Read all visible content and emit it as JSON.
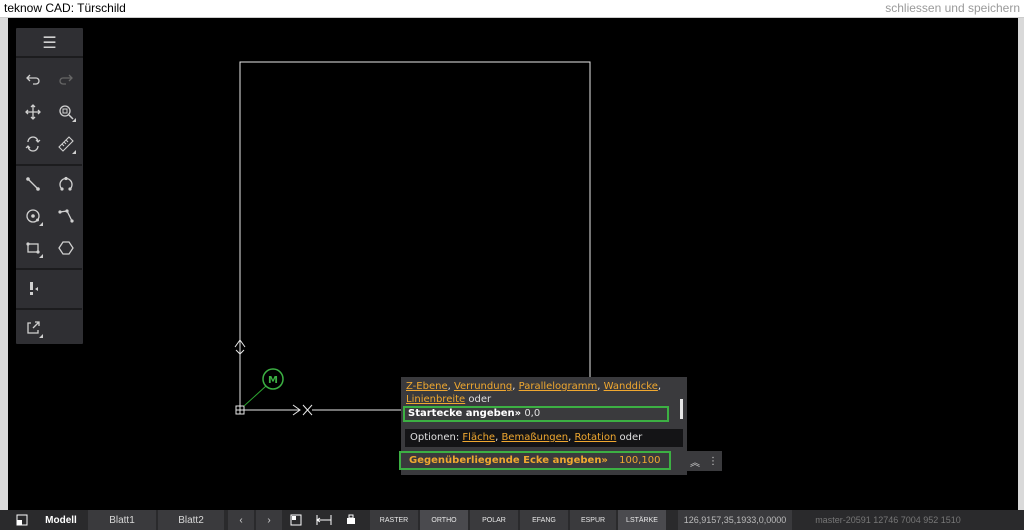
{
  "window": {
    "title": "teknow CAD: Türschild",
    "close_label": "schliessen und speichern"
  },
  "toolbar": {
    "menu_icon": "hamburger-icon",
    "tools": [
      {
        "name": "undo",
        "icon": "undo-icon"
      },
      {
        "name": "redo",
        "icon": "redo-icon"
      },
      {
        "name": "pan",
        "icon": "move-icon"
      },
      {
        "name": "zoom",
        "icon": "zoom-icon"
      },
      {
        "name": "orbit",
        "icon": "rotate-icon"
      },
      {
        "name": "measure",
        "icon": "ruler-icon"
      },
      {
        "name": "line",
        "icon": "line-icon"
      },
      {
        "name": "arc",
        "icon": "arc-icon"
      },
      {
        "name": "circle",
        "icon": "circle-icon"
      },
      {
        "name": "polyline",
        "icon": "polyline-icon"
      },
      {
        "name": "rectangle",
        "icon": "rectangle-icon"
      },
      {
        "name": "polygon",
        "icon": "hexagon-icon"
      },
      {
        "name": "error-check",
        "icon": "warning-icon"
      },
      {
        "name": "export",
        "icon": "export-icon"
      }
    ]
  },
  "drawing": {
    "marker_label": "M"
  },
  "command": {
    "history_line1_options": [
      "Z-Ebene",
      "Verrundung",
      "Parallelogramm",
      "Wanddicke"
    ],
    "history_line2_option": "Linienbreite",
    "history_oder": "oder",
    "start_prompt": "Startecke angeben»",
    "start_value": "0,0",
    "options_prefix": "Optionen:",
    "options": [
      "Fläche",
      "Bemaßungen",
      "Rotation"
    ],
    "options_suffix": "oder",
    "input_prompt": "Gegenüberliegende Ecke angeben»",
    "input_value": "100,100"
  },
  "bottom": {
    "tabs": [
      "Modell",
      "Blatt1",
      "Blatt2"
    ],
    "nav_prev": "‹",
    "nav_next": "›",
    "toggles": [
      {
        "label": "RASTER",
        "on": false
      },
      {
        "label": "ORTHO",
        "on": true
      },
      {
        "label": "POLAR",
        "on": false
      },
      {
        "label": "EFANG",
        "on": false
      },
      {
        "label": "ESPUR",
        "on": false
      },
      {
        "label": "LSTÄRKE",
        "on": true
      }
    ],
    "coordinates": "126,9157,35,1933,0,0000",
    "version": "master-20591 12746 7004 952 1510"
  },
  "colors": {
    "accent_green": "#3cb043",
    "option_orange": "#f0a830",
    "canvas": "#000000",
    "panel": "#3a3a3d"
  }
}
